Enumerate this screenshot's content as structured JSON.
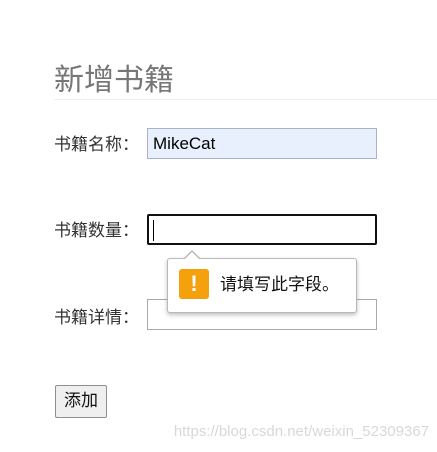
{
  "page": {
    "title": "新增书籍"
  },
  "form": {
    "name_label": "书籍名称：",
    "name_value": "MikeCat",
    "quantity_label": "书籍数量：",
    "quantity_value": "",
    "detail_label": "书籍详情：",
    "detail_value": "",
    "submit_label": "添加"
  },
  "validation": {
    "icon": "warning-icon",
    "icon_glyph": "!",
    "message": "请填写此字段。",
    "icon_color": "#f5a00d"
  },
  "watermark": {
    "text": "https://blog.csdn.net/weixin_52309367"
  }
}
